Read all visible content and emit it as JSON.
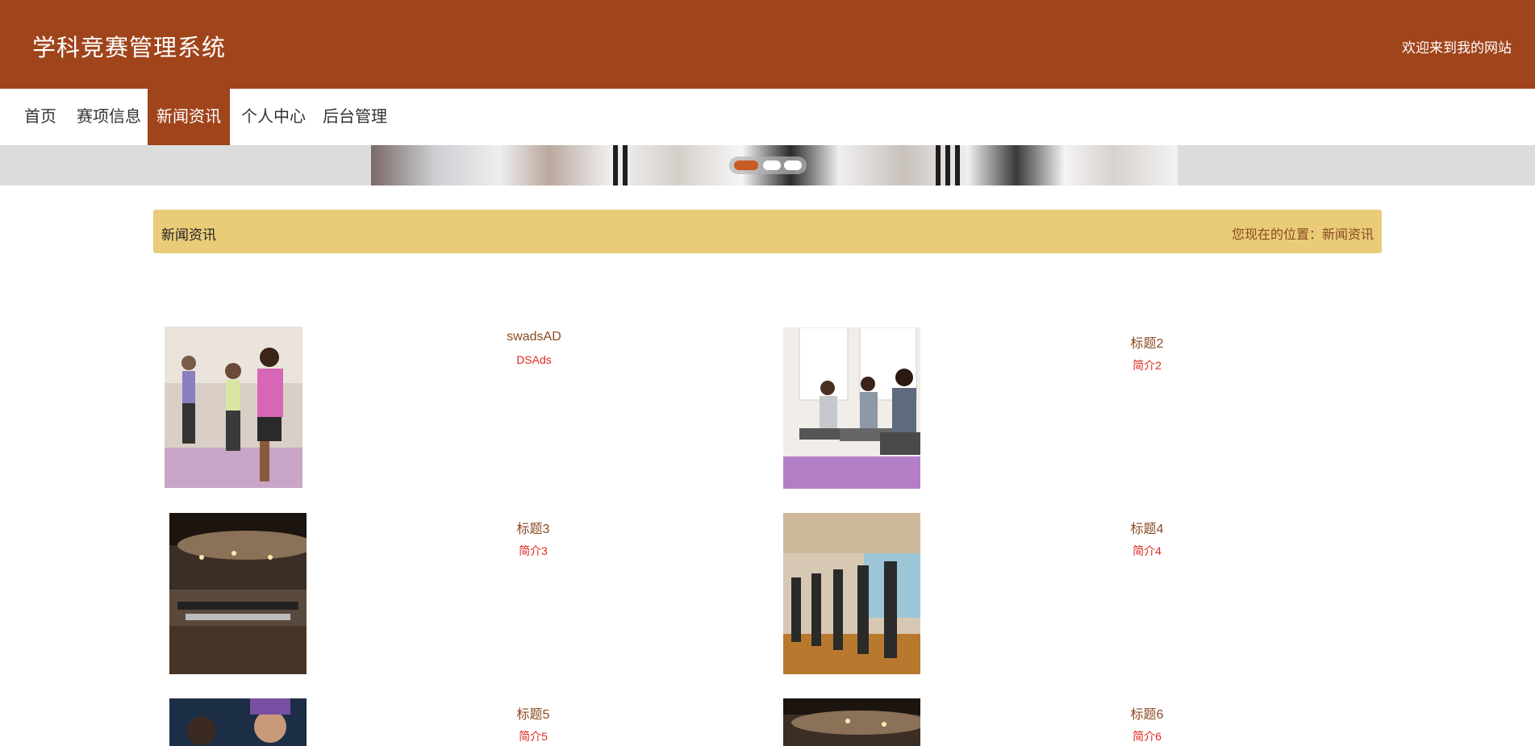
{
  "header": {
    "site_title": "学科竞赛管理系统",
    "welcome": "欢迎来到我的网站"
  },
  "nav": {
    "items": [
      {
        "label": "首页"
      },
      {
        "label": "赛项信息"
      },
      {
        "label": "新闻资讯"
      },
      {
        "label": "个人中心"
      },
      {
        "label": "后台管理"
      }
    ],
    "active": "新闻资讯"
  },
  "banner": {
    "slides": 3,
    "active_slide": 1
  },
  "breadcrumb": {
    "title": "新闻资讯",
    "location": "您现在的位置：新闻资讯"
  },
  "news": [
    {
      "title": "swadsAD",
      "intro": "DSAds",
      "image": "yoga-class-photo"
    },
    {
      "title": "标题2",
      "intro": "简介2",
      "image": "yoga-stretch-photo"
    },
    {
      "title": "标题3",
      "intro": "简介3",
      "image": "gym-interior-photo"
    },
    {
      "title": "标题4",
      "intro": "简介4",
      "image": "treadmill-row-photo"
    },
    {
      "title": "标题5",
      "intro": "简介5",
      "image": "boxing-woman-photo"
    },
    {
      "title": "标题6",
      "intro": "简介6",
      "image": "gym-interior-photo"
    }
  ],
  "colors": {
    "brand": "#a0441b",
    "breadcrumb_bg": "#e9cb78",
    "news_title": "#8a4a22",
    "news_intro": "#e0281f"
  }
}
